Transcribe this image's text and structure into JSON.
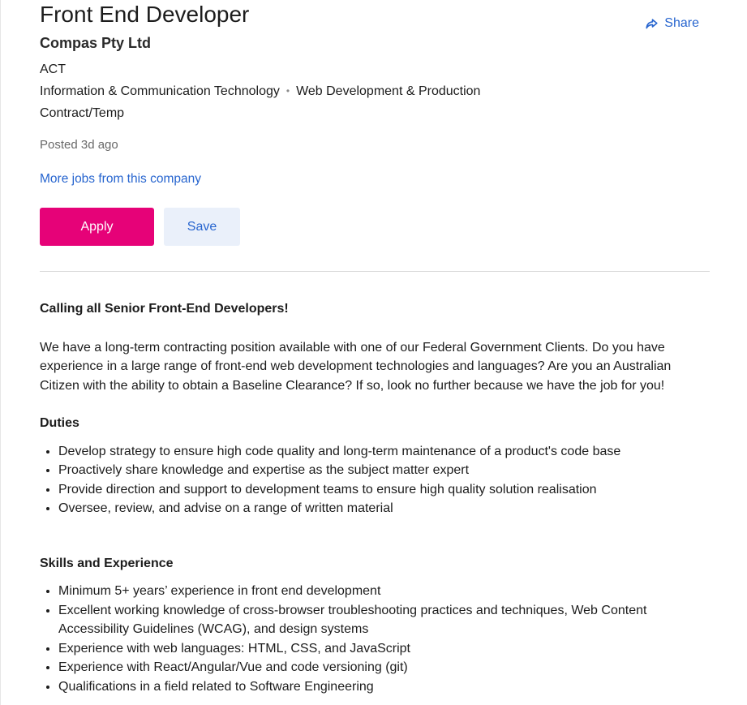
{
  "job": {
    "title": "Front End Developer",
    "company": "Compas Pty Ltd",
    "location": "ACT",
    "classification": "Information & Communication Technology",
    "subclassification": "Web Development & Production",
    "work_type": "Contract/Temp",
    "posted": "Posted 3d ago",
    "more_jobs_link": "More jobs from this company"
  },
  "actions": {
    "share_label": "Share",
    "apply_label": "Apply",
    "save_label": "Save"
  },
  "description": {
    "intro_heading": "Calling all Senior Front-End Developers!",
    "intro_paragraph": "We have a long-term contracting position available with one of our Federal Government Clients. Do you have experience in a large range of front-end web development technologies and languages? Are you an Australian Citizen with the ability to obtain a Baseline Clearance? If so, look no further because we have the job for you!",
    "duties_heading": "Duties",
    "duties": [
      "Develop strategy to ensure high code quality and long-term maintenance of a product's code base",
      "Proactively share knowledge and expertise as the subject matter expert",
      "Provide direction and support to development teams to ensure high quality solution realisation",
      "Oversee, review, and advise on a range of written material"
    ],
    "skills_heading": "Skills and Experience",
    "skills": [
      "Minimum 5+ years’ experience in front end development",
      "Excellent working knowledge of cross-browser troubleshooting practices and techniques, Web Content Accessibility Guidelines (WCAG), and design systems",
      "Experience with web languages: HTML, CSS, and JavaScript",
      "Experience with React/Angular/Vue and code versioning (git)",
      "Qualifications in a field related to Software Engineering"
    ]
  },
  "colors": {
    "accent_link": "#2765cf",
    "apply_button": "#e60278",
    "save_button_bg": "#eaf0fa"
  },
  "icons": {
    "share": "share-arrow-icon"
  }
}
